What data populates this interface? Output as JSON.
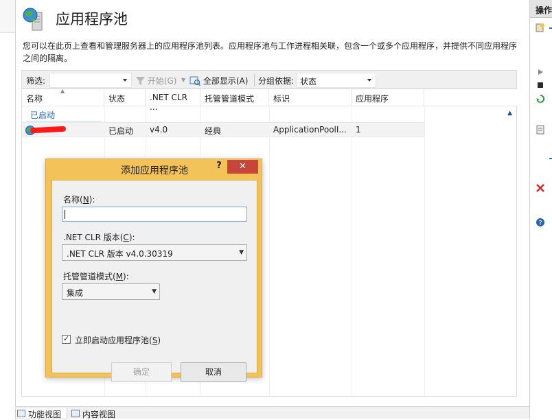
{
  "page": {
    "title": "应用程序池",
    "description": "您可以在此页上查看和管理服务器上的应用程序池列表。应用程序池与工作进程相关联，包含一个或多个应用程序，并提供不同应用程序之间的隔离。"
  },
  "toolbar": {
    "filter_label": "筛选:",
    "filter_value": "",
    "start_label": "开始(G)",
    "show_all_label": "全部显示(A)",
    "group_by_label": "分组依据:",
    "group_by_value": "状态"
  },
  "grid": {
    "columns": [
      "名称",
      "状态",
      ".NET CLR ...",
      "托管管道模式",
      "标识",
      "应用程序"
    ],
    "group_label": "已启动",
    "rows": [
      {
        "name": "",
        "status": "已启动",
        "clr": "v4.0",
        "pipeline": "经典",
        "identity": "ApplicationPoolI...",
        "apps": "1"
      }
    ]
  },
  "bottom_tabs": {
    "features_view": "功能视图",
    "content_view": "内容视图"
  },
  "right_pane": {
    "header": "操作"
  },
  "dialog": {
    "title": "添加应用程序池",
    "help": "?",
    "name_label_prefix": "名称(",
    "name_label_key": "N",
    "name_label_suffix": "):",
    "name_value": "",
    "clr_label_prefix": ".NET CLR 版本(",
    "clr_label_key": "C",
    "clr_label_suffix": "):",
    "clr_value": ".NET CLR 版本 v4.0.30319",
    "pipeline_label_prefix": "托管管道模式(",
    "pipeline_label_key": "M",
    "pipeline_label_suffix": "):",
    "pipeline_value": "集成",
    "start_label_prefix": "立即启动应用程序池(",
    "start_label_key": "S",
    "start_label_suffix": ")",
    "start_checked": true,
    "ok_label": "确定",
    "cancel_label": "取消"
  },
  "colors": {
    "dialog_frame": "#f3c35a",
    "close_button": "#c7453b",
    "link_blue": "#2a6ab8"
  }
}
